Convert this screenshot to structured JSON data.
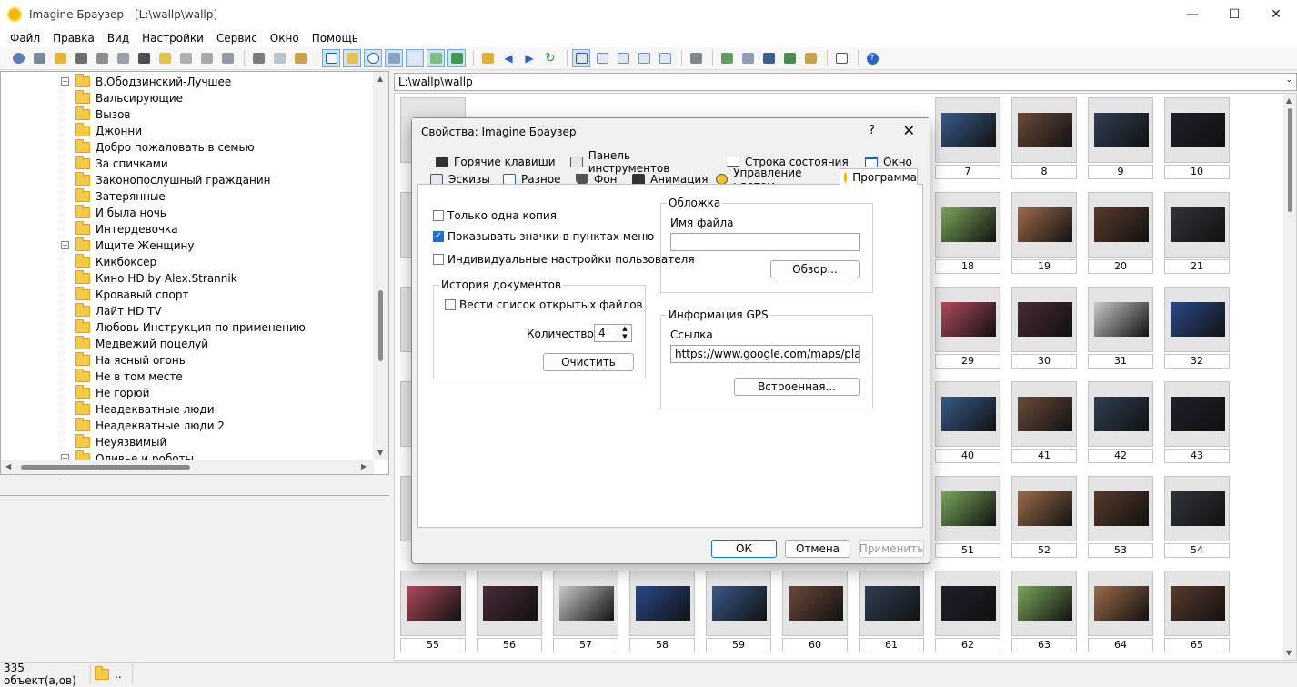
{
  "window": {
    "title": "Imagine Браузер - [L:\\wallp\\wallp]"
  },
  "menu": [
    "Файл",
    "Правка",
    "Вид",
    "Настройки",
    "Сервис",
    "Окно",
    "Помощь"
  ],
  "tree": {
    "items": [
      {
        "label": "В.Ободзинский-Лучшее",
        "expander": true
      },
      {
        "label": "Вальсирующие",
        "expander": false
      },
      {
        "label": "Вызов",
        "expander": false
      },
      {
        "label": "Джонни",
        "expander": false
      },
      {
        "label": "Добро пожаловать в семью",
        "expander": false
      },
      {
        "label": "За спичками",
        "expander": false
      },
      {
        "label": "Законопослушный гражданин",
        "expander": false
      },
      {
        "label": "Затерянные",
        "expander": false
      },
      {
        "label": "И была ночь",
        "expander": false
      },
      {
        "label": "Интердевочка",
        "expander": false
      },
      {
        "label": "Ищите Женщину",
        "expander": true
      },
      {
        "label": "Кикбоксер",
        "expander": false
      },
      {
        "label": "Кино HD by Alex.Strannik",
        "expander": false
      },
      {
        "label": "Кровавый спорт",
        "expander": false
      },
      {
        "label": "Лайт HD TV",
        "expander": false
      },
      {
        "label": "Любовь Инструкция по применению",
        "expander": false
      },
      {
        "label": "Медвежий поцелуй",
        "expander": false
      },
      {
        "label": "На ясный огонь",
        "expander": false
      },
      {
        "label": "Не в том месте",
        "expander": false
      },
      {
        "label": "Не горюй",
        "expander": false
      },
      {
        "label": "Неадекватные люди",
        "expander": false
      },
      {
        "label": "Неадекватные люди 2",
        "expander": false
      },
      {
        "label": "Неуязвимый",
        "expander": false
      },
      {
        "label": "Оливье и роботы",
        "expander": true
      }
    ]
  },
  "path": "L:\\wallp\\wallp",
  "thumbs": {
    "rows": [
      [
        "7",
        "8",
        "9",
        "10"
      ],
      [
        "18",
        "19",
        "20",
        "21"
      ],
      [
        "29",
        "30",
        "31",
        "32"
      ],
      [
        "40",
        "41",
        "42",
        "43"
      ],
      [
        "51",
        "52",
        "53",
        "54"
      ],
      [
        "55",
        "56",
        "57",
        "58",
        "59",
        "60",
        "61",
        "62",
        "63",
        "64",
        "65"
      ]
    ]
  },
  "status": {
    "count": "335 объект(а,ов)",
    "folder": ".."
  },
  "dialog": {
    "title": "Свойства: Imagine Браузер",
    "help": "?",
    "close": "✕",
    "tabs_row1": [
      "Горячие клавиши",
      "Панель инструментов",
      "Строка состояния",
      "Окно"
    ],
    "tabs_row2": [
      "Эскизы",
      "Разное",
      "Фон",
      "Анимация",
      "Управление цветом",
      "Программа"
    ],
    "chk_single": "Только одна копия",
    "chk_icons": "Показывать значки в пунктах меню",
    "chk_individual": "Индивидуальные настройки пользователя",
    "history_title": "История документов",
    "chk_history": "Вести список открытых файлов",
    "count_label": "Количество:",
    "count_value": "4",
    "clear_btn": "Очистить",
    "cover_title": "Обложка",
    "filename_label": "Имя файла",
    "filename_value": "",
    "browse_btn": "Обзор...",
    "gps_title": "Информация GPS",
    "link_label": "Ссылка",
    "link_value": "https://www.google.com/maps/place/<LA",
    "builtin_btn": "Встроенная...",
    "ok": "ОК",
    "cancel": "Отмена",
    "apply": "Применить"
  }
}
